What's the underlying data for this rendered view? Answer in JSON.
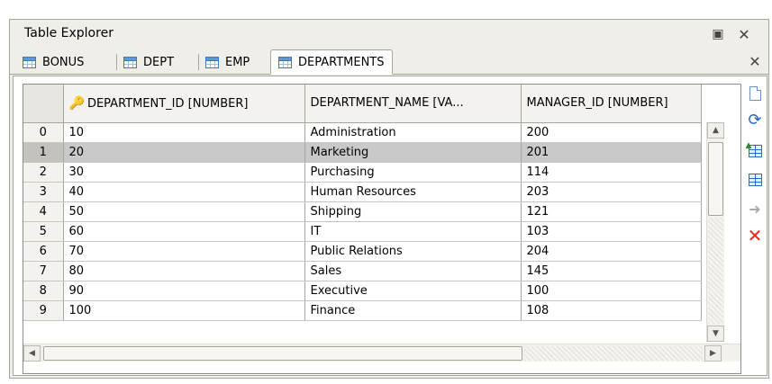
{
  "window": {
    "title": "Table Explorer"
  },
  "tabs": [
    {
      "label": "BONUS"
    },
    {
      "label": "DEPT"
    },
    {
      "label": "EMP"
    },
    {
      "label": "DEPARTMENTS"
    }
  ],
  "columns": {
    "id": "DEPARTMENT_ID [NUMBER]",
    "name": "DEPARTMENT_NAME [VA...",
    "manager": "MANAGER_ID [NUMBER]"
  },
  "rows": [
    {
      "n": "0",
      "id": "10",
      "name": "Administration",
      "manager": "200"
    },
    {
      "n": "1",
      "id": "20",
      "name": "Marketing",
      "manager": "201"
    },
    {
      "n": "2",
      "id": "30",
      "name": "Purchasing",
      "manager": "114"
    },
    {
      "n": "3",
      "id": "40",
      "name": "Human Resources",
      "manager": "203"
    },
    {
      "n": "4",
      "id": "50",
      "name": "Shipping",
      "manager": "121"
    },
    {
      "n": "5",
      "id": "60",
      "name": "IT",
      "manager": "103"
    },
    {
      "n": "6",
      "id": "70",
      "name": "Public Relations",
      "manager": "204"
    },
    {
      "n": "7",
      "id": "80",
      "name": "Sales",
      "manager": "145"
    },
    {
      "n": "8",
      "id": "90",
      "name": "Executive",
      "manager": "100"
    },
    {
      "n": "9",
      "id": "100",
      "name": "Finance",
      "manager": "108"
    }
  ],
  "toolbar": {
    "icons": [
      "new-row-icon",
      "refresh-icon",
      "move-up-icon",
      "move-down-icon",
      "commit-arrow-icon",
      "delete-icon"
    ]
  },
  "colors": {
    "accent": "#3b78c8",
    "selected_row": "#c9c9c9",
    "delete": "#e02b14"
  }
}
